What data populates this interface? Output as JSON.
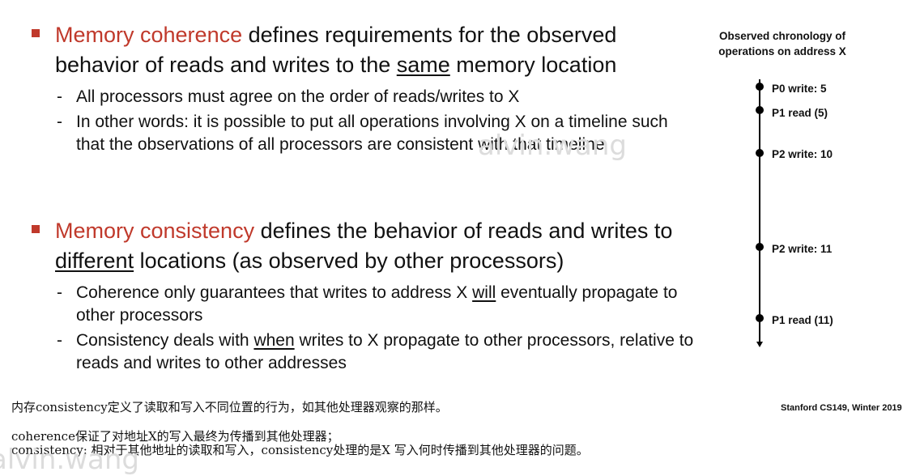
{
  "bullet1": {
    "term": "Memory coherence",
    "rest_a": " defines requirements for the observed behavior of reads and writes to the ",
    "underlined": "same",
    "rest_b": " memory location",
    "subs": [
      "All processors must agree on the order of reads/writes to X",
      "In other words: it is possible to put all operations involving X on a timeline such that the observations of all processors are consistent with that timeline"
    ]
  },
  "bullet2": {
    "term": "Memory consistency",
    "rest_a": " defines the behavior of reads and writes to ",
    "underlined": "different",
    "rest_b": " locations (as observed by other processors)",
    "sub1": {
      "a": "Coherence only guarantees that writes to address X ",
      "u": "will",
      "b": " eventually propagate to other processors"
    },
    "sub2": {
      "a": "Consistency deals with ",
      "u": "when",
      "b": " writes to X propagate to other processors, relative to reads and writes to other addresses"
    }
  },
  "timeline": {
    "title_line1": "Observed chronology of",
    "title_line2": "operations on address X",
    "events": [
      {
        "label": "P0 write: 5",
        "order": 1
      },
      {
        "label": "P1 read (5)",
        "order": 2
      },
      {
        "label": "P2 write: 10",
        "order": 3
      },
      {
        "label": "P2 write: 11",
        "order": 4
      },
      {
        "label": "P1 read (11)",
        "order": 5
      }
    ]
  },
  "notes": [
    "内存consistency定义了读取和写入不同位置的行为，如其他处理器观察的那样。",
    "coherence保证了对地址X的写入最终为传播到其他处理器；",
    "consistency: 相对于其他地址的读取和写入，consistency处理的是X 写入何时传播到其他处理器的问题。"
  ],
  "footer": "Stanford CS149, Winter 2019",
  "watermark": "alvin.wang"
}
